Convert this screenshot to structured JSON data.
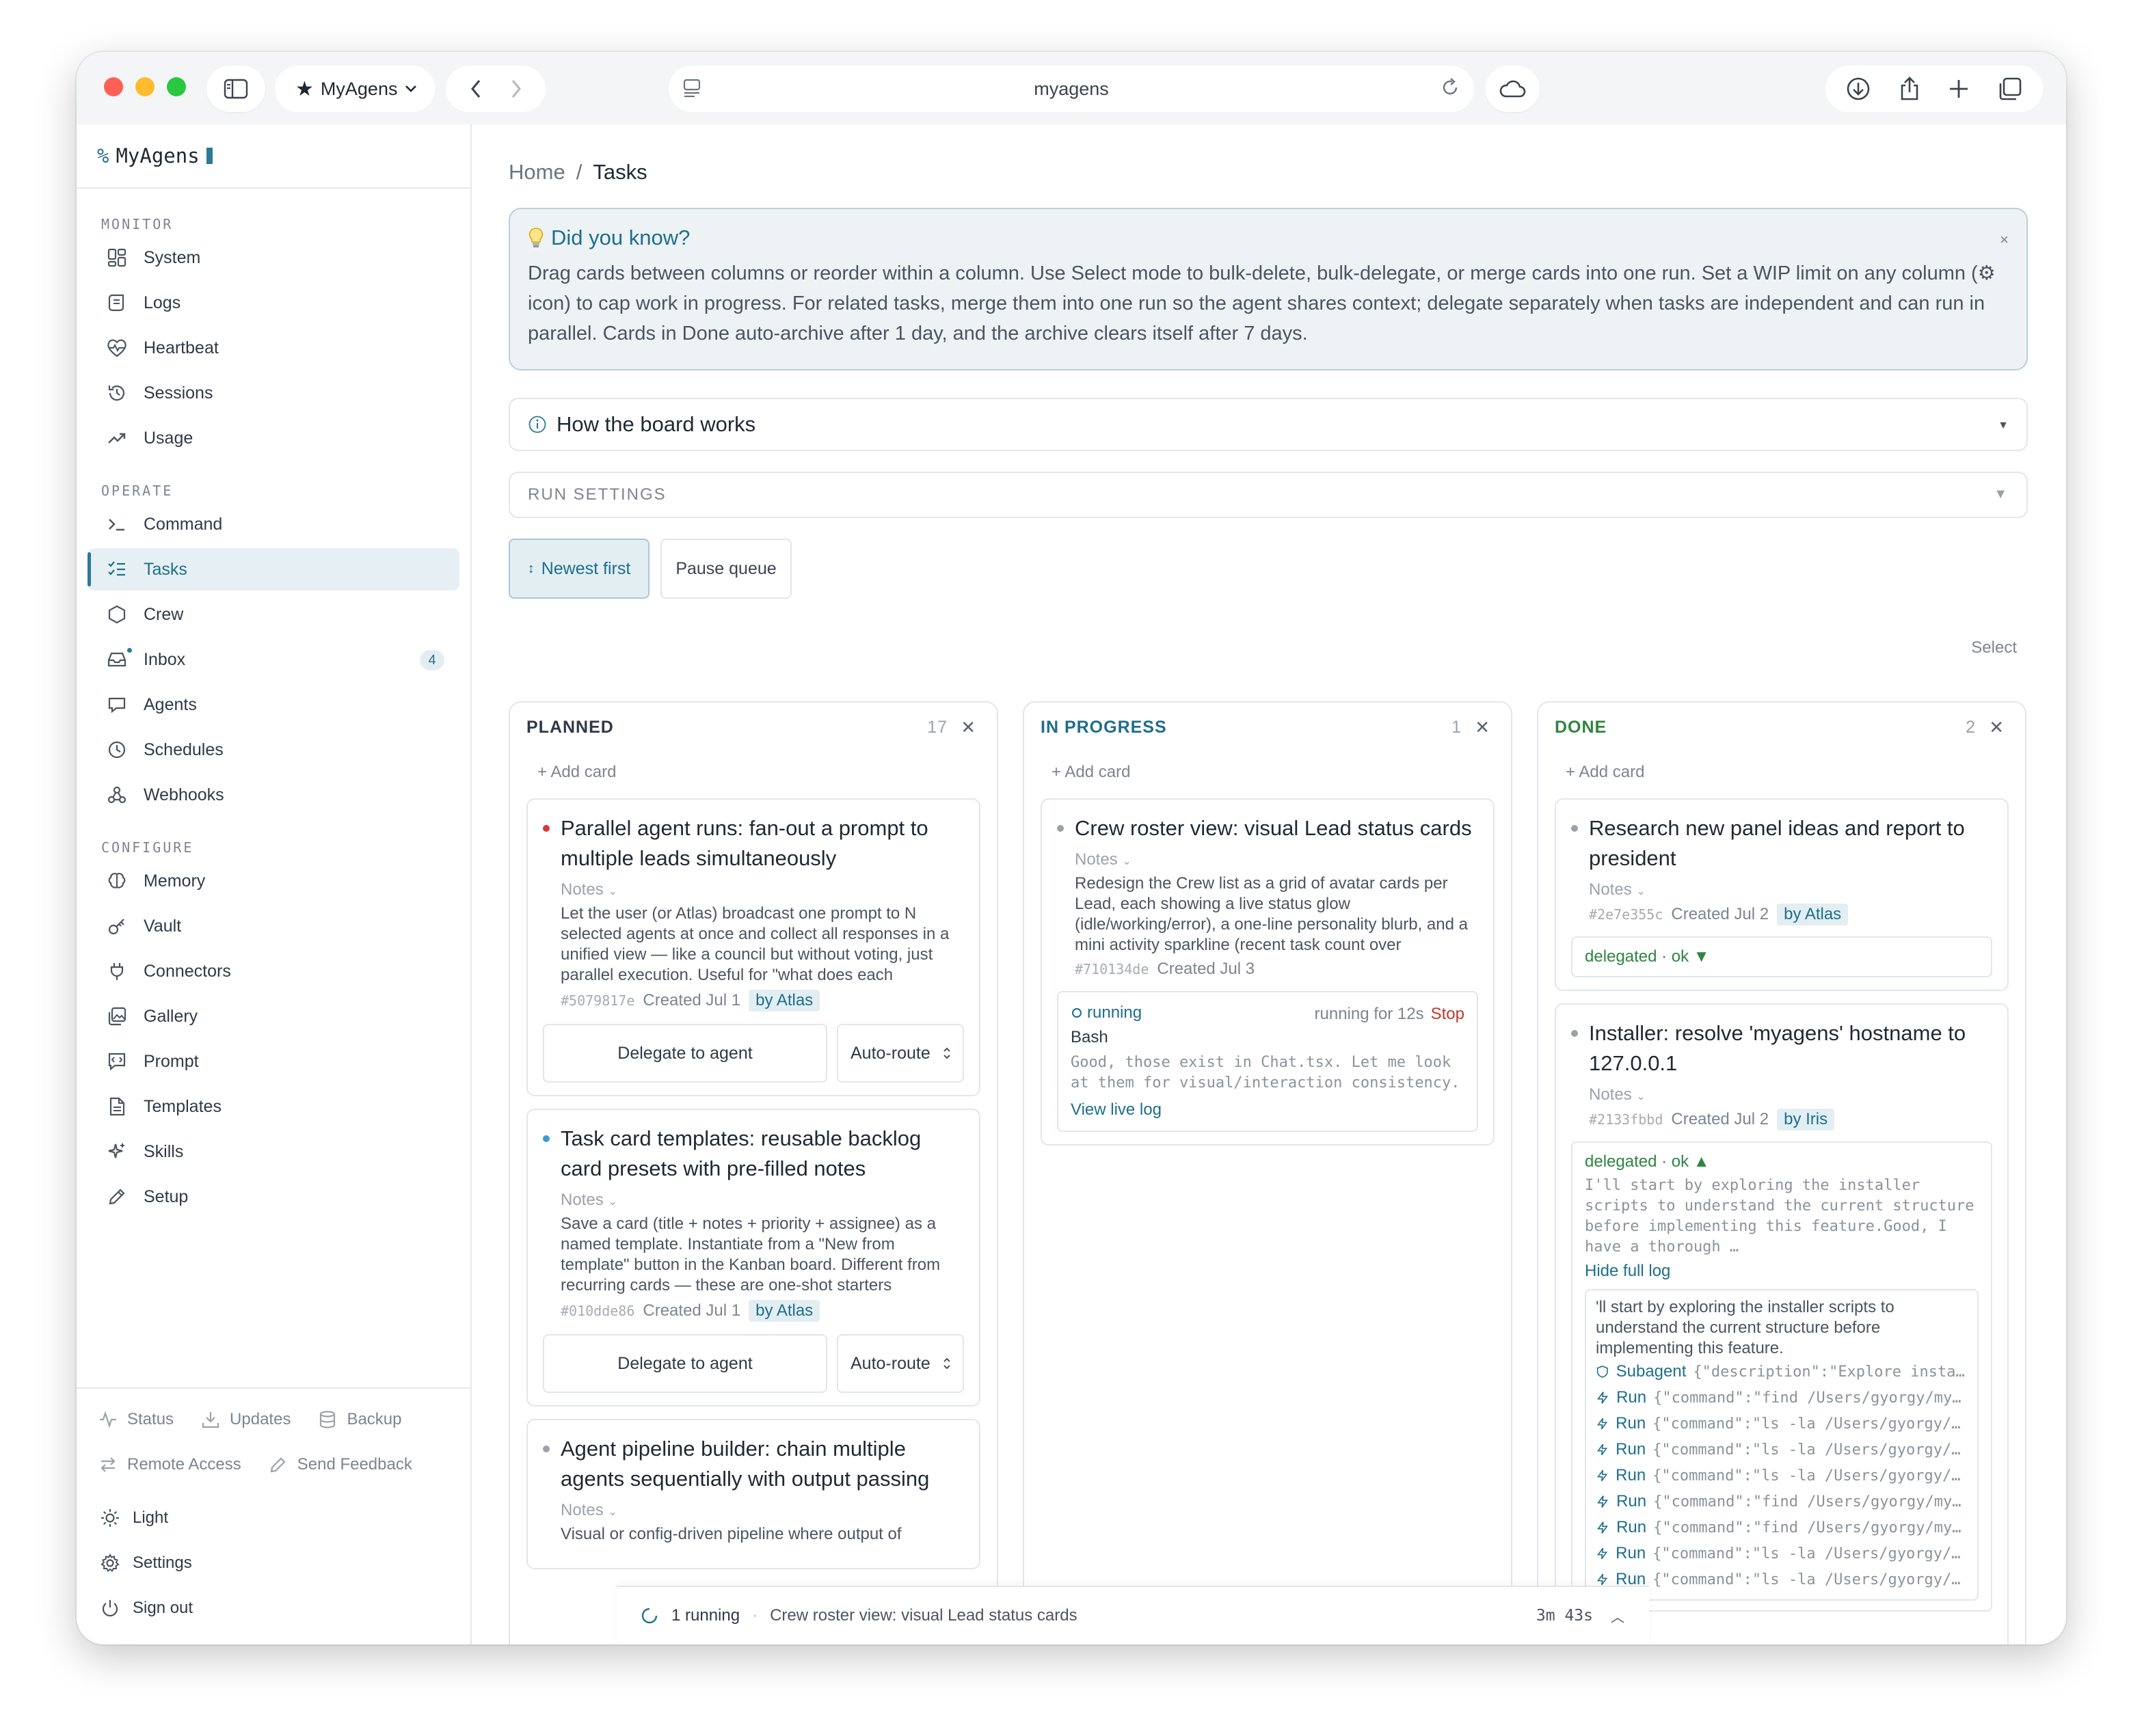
{
  "browser": {
    "tab_title": "MyAgens",
    "url": "myagens"
  },
  "sidebar": {
    "brand_prefix": "%",
    "brand": "MyAgens",
    "sections": {
      "monitor": "MONITOR",
      "operate": "OPERATE",
      "configure": "CONFIGURE"
    },
    "monitor_items": [
      "System",
      "Logs",
      "Heartbeat",
      "Sessions",
      "Usage"
    ],
    "operate_items": [
      "Command",
      "Tasks",
      "Crew",
      "Inbox",
      "Agents",
      "Schedules",
      "Webhooks"
    ],
    "configure_items": [
      "Memory",
      "Vault",
      "Connectors",
      "Gallery",
      "Prompt",
      "Templates",
      "Skills",
      "Setup"
    ],
    "inbox_badge": "4",
    "footer": {
      "status": "Status",
      "updates": "Updates",
      "backup": "Backup",
      "remote_access": "Remote Access",
      "send_feedback": "Send Feedback",
      "light": "Light",
      "settings": "Settings",
      "sign_out": "Sign out"
    }
  },
  "main": {
    "breadcrumb": {
      "home": "Home",
      "sep": "/",
      "current": "Tasks"
    },
    "tip": {
      "title": "Did you know?",
      "body": "Drag cards between columns or reorder within a column. Use Select mode to bulk-delete, bulk-delegate, or merge cards into one run. Set a WIP limit on any column (⚙ icon) to cap work in progress. For related tasks, merge them into one run so the agent shares context; delegate separately when tasks are independent and can run in parallel. Cards in Done auto-archive after 1 day, and the archive clears itself after 7 days.",
      "close": "×"
    },
    "how_board_works": "How the board works",
    "run_settings": "RUN SETTINGS",
    "newest_first": "Newest first",
    "pause_queue": "Pause queue",
    "select": "Select"
  },
  "columns": {
    "planned": {
      "title": "PLANNED",
      "count": "17",
      "add_card": "+ Add card",
      "cards": [
        {
          "title": "Parallel agent runs: fan-out a prompt to multiple leads simultaneously",
          "notes_label": "Notes",
          "notes": "Let the user (or Atlas) broadcast one prompt to N selected agents at once and collect all responses in a unified view — like a council but without voting, just parallel execution. Useful for \"what does each",
          "id": "#5079817e",
          "created": "Created Jul 1",
          "by": "by Atlas",
          "delegate": "Delegate to agent",
          "route": "Auto-route"
        },
        {
          "title": "Task card templates: reusable backlog card presets with pre-filled notes",
          "notes_label": "Notes",
          "notes": "Save a card (title + notes + priority + assignee) as a named template. Instantiate from a \"New from template\" button in the Kanban board. Different from recurring cards — these are one-shot starters",
          "id": "#010dde86",
          "created": "Created Jul 1",
          "by": "by Atlas",
          "delegate": "Delegate to agent",
          "route": "Auto-route"
        },
        {
          "title": "Agent pipeline builder: chain multiple agents sequentially with output passing",
          "notes_label": "Notes",
          "notes": "Visual or config-driven pipeline where output of"
        }
      ]
    },
    "in_progress": {
      "title": "IN PROGRESS",
      "count": "1",
      "add_card": "+ Add card",
      "cards": [
        {
          "title": "Crew roster view: visual Lead status cards",
          "notes_label": "Notes",
          "notes": "Redesign the Crew list as a grid of avatar cards per Lead, each showing a live status glow (idle/working/error), a one-line personality blurb, and a mini activity sparkline (recent task count over",
          "id": "#710134de",
          "created": "Created Jul 3",
          "run_status": "running",
          "run_time": "running for 12s",
          "stop": "Stop",
          "tool": "Bash",
          "output": "Good, those exist in Chat.tsx. Let me look at them for visual/interaction consistency.",
          "view_log": "View live log"
        }
      ]
    },
    "done": {
      "title": "DONE",
      "count": "2",
      "add_card": "+ Add card",
      "cards": [
        {
          "title": "Research new panel ideas and report to president",
          "notes_label": "Notes",
          "id": "#2e7e355c",
          "created": "Created Jul 2",
          "by": "by Atlas",
          "delegated": "delegated · ok ▼"
        },
        {
          "title": "Installer: resolve 'myagens' hostname to 127.0.0.1",
          "notes_label": "Notes",
          "id": "#2133fbbd",
          "created": "Created Jul 2",
          "by": "by Iris",
          "delegated": "delegated · ok ▲",
          "delegated_output": "I'll start by exploring the installer scripts to understand the current structure before implementing this feature.Good, I have a thorough …",
          "hide_log": "Hide full log",
          "log_text": "'ll start by exploring the installer scripts to understand the current structure before implementing this feature.",
          "log_lines": [
            {
              "label": "Subagent",
              "arg": "{\"description\":\"Explore installer\""
            },
            {
              "label": "Run",
              "arg": "{\"command\":\"find /Users/gyorgy/myagens"
            },
            {
              "label": "Run",
              "arg": "{\"command\":\"ls -la /Users/gyorgy/myagens"
            },
            {
              "label": "Run",
              "arg": "{\"command\":\"ls -la /Users/gyorgy/myagens"
            },
            {
              "label": "Run",
              "arg": "{\"command\":\"ls -la /Users/gyorgy/myagens"
            },
            {
              "label": "Run",
              "arg": "{\"command\":\"find /Users/gyorgy/myagens"
            },
            {
              "label": "Run",
              "arg": "{\"command\":\"find /Users/gyorgy/myagens"
            },
            {
              "label": "Run",
              "arg": "{\"command\":\"ls -la /Users/gyorgy/myagens"
            },
            {
              "label": "Run",
              "arg": "{\"command\":\"ls -la /Users/gyorgy/myagens"
            }
          ]
        }
      ]
    }
  },
  "runbar": {
    "running": "1 running",
    "sep": "·",
    "task": "Crew roster view: visual Lead status cards",
    "elapsed": "3m 43s"
  },
  "colors": {
    "accent": "#1d6e8c",
    "priority_high": "#d23b3b",
    "priority_medium": "#3a9bd5",
    "priority_low": "#9aa2ab",
    "ok": "#2e8540",
    "stop": "#c0392b"
  }
}
